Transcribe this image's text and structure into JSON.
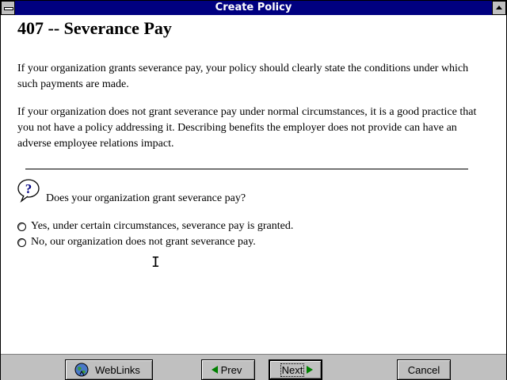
{
  "window": {
    "title": "Create Policy"
  },
  "page": {
    "heading": "407 -- Severance Pay",
    "paragraph1": "If your organization grants severance pay, your policy should clearly state the conditions under which such payments are made.",
    "paragraph2": "If your organization does not grant severance pay under normal circumstances, it is a good practice that you not have a policy addressing it. Describing benefits the employer does not provide can have an adverse employee relations impact.",
    "question": "Does your organization grant severance pay?",
    "options": [
      {
        "label": "Yes, under certain circumstances, severance pay is granted.",
        "selected": false
      },
      {
        "label": "No, our organization does not grant severance pay.",
        "selected": false
      }
    ]
  },
  "buttons": {
    "weblinks": "WebLinks",
    "prev": "Prev",
    "next": "Next",
    "cancel": "Cancel"
  },
  "icons": {
    "question": "question-balloon-icon",
    "weblinks": "globe-icon",
    "prev": "green-left-arrow-icon",
    "next": "green-right-arrow-icon"
  },
  "colors": {
    "titlebar": "#000080",
    "button_face": "#c0c0c0",
    "arrow": "#008000"
  }
}
